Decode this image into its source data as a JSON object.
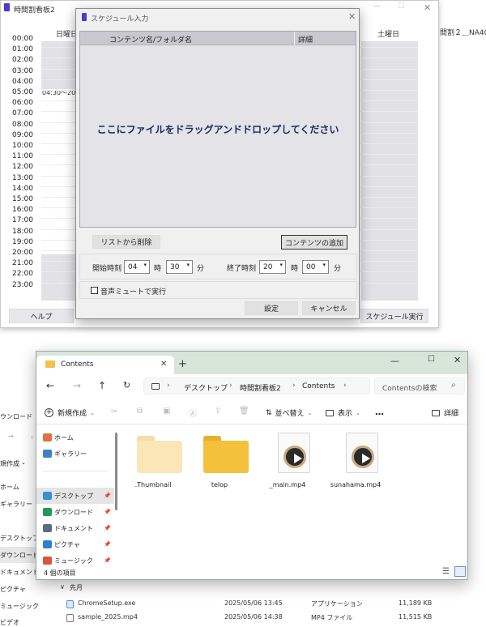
{
  "schedule_window": {
    "title": "時間割看板2",
    "right_title_fragment": "間割２＿NA40",
    "weekday_first": "日曜日",
    "weekday_last": "土曜日",
    "times": [
      "00:00",
      "01:00",
      "02:00",
      "03:00",
      "04:00",
      "05:00",
      "06:00",
      "07:00",
      "08:00",
      "09:00",
      "10:00",
      "11:00",
      "12:00",
      "13:00",
      "14:00",
      "15:00",
      "16:00",
      "17:00",
      "18:00",
      "19:00",
      "20:00",
      "21:00",
      "22:00",
      "23:00"
    ],
    "block_label": "04:30～20:0",
    "help_button": "ヘルプ",
    "run_button": "スケジュール実行"
  },
  "dialog": {
    "title": "スケジュール入力",
    "col_name": "コンテンツ名/フォルダ名",
    "col_detail": "詳細",
    "drop_hint": "ここにファイルをドラッグアンドドロップしてください",
    "remove_button": "リストから削除",
    "add_button": "コンテンツの追加",
    "start_label": "開始時刻",
    "start_hour": "04",
    "start_minute": "30",
    "end_label": "終了時刻",
    "end_hour": "20",
    "end_minute": "00",
    "hour_unit": "時",
    "minute_unit": "分",
    "mute_label": "音声ミュートで実行",
    "mute_checked": false,
    "set_button": "設定",
    "cancel_button": "キャンセル"
  },
  "contents_window": {
    "tab_title": "Contents",
    "breadcrumb": [
      "デスクトップ",
      "時間割看板2",
      "Contents"
    ],
    "search_placeholder": "Contentsの検索",
    "toolbar": {
      "new": "新規作成",
      "sort": "並べ替え",
      "view": "表示",
      "more": "…",
      "details": "詳細"
    },
    "sidebar": [
      {
        "label": "ホーム",
        "icon": "home-icon",
        "color": "#e1713b"
      },
      {
        "label": "ギャラリー",
        "icon": "gallery-icon",
        "color": "#3b82c4"
      },
      {
        "label": "デスクトップ",
        "icon": "desktop-icon",
        "color": "#3b8fd6"
      },
      {
        "label": "ダウンロード",
        "icon": "download-icon",
        "color": "#1f9b5a"
      },
      {
        "label": "ドキュメント",
        "icon": "document-icon",
        "color": "#5b6b80"
      },
      {
        "label": "ピクチャ",
        "icon": "picture-icon",
        "color": "#2f7fd0"
      },
      {
        "label": "ミュージック",
        "icon": "music-icon",
        "color": "#e0533d"
      }
    ],
    "files": [
      {
        "name": ".Thumbnail",
        "kind": "folder",
        "faded": true
      },
      {
        "name": "telop",
        "kind": "folder",
        "faded": false
      },
      {
        "name": "_main.mp4",
        "kind": "video"
      },
      {
        "name": "sunahama.mp4",
        "kind": "video"
      }
    ],
    "status": "4 個の項目"
  },
  "background_explorer": {
    "title_fragment": "ウンロード",
    "new_fragment": "規作成",
    "nav": [
      "ホーム",
      "ギャラリー",
      "デスクトップ",
      "ダウンロード",
      "ドキュメント",
      "ピクチャ",
      "ミュージック",
      "ビデオ"
    ],
    "group": "先月",
    "rows": [
      {
        "name": "ChromeSetup.exe",
        "date": "2025/05/06 13:45",
        "type": "アプリケーション",
        "size": "11,189 KB"
      },
      {
        "name": "sample_2025.mp4",
        "date": "2025/05/06 14:38",
        "type": "MP4 ファイル",
        "size": "11,515 KB"
      }
    ]
  }
}
